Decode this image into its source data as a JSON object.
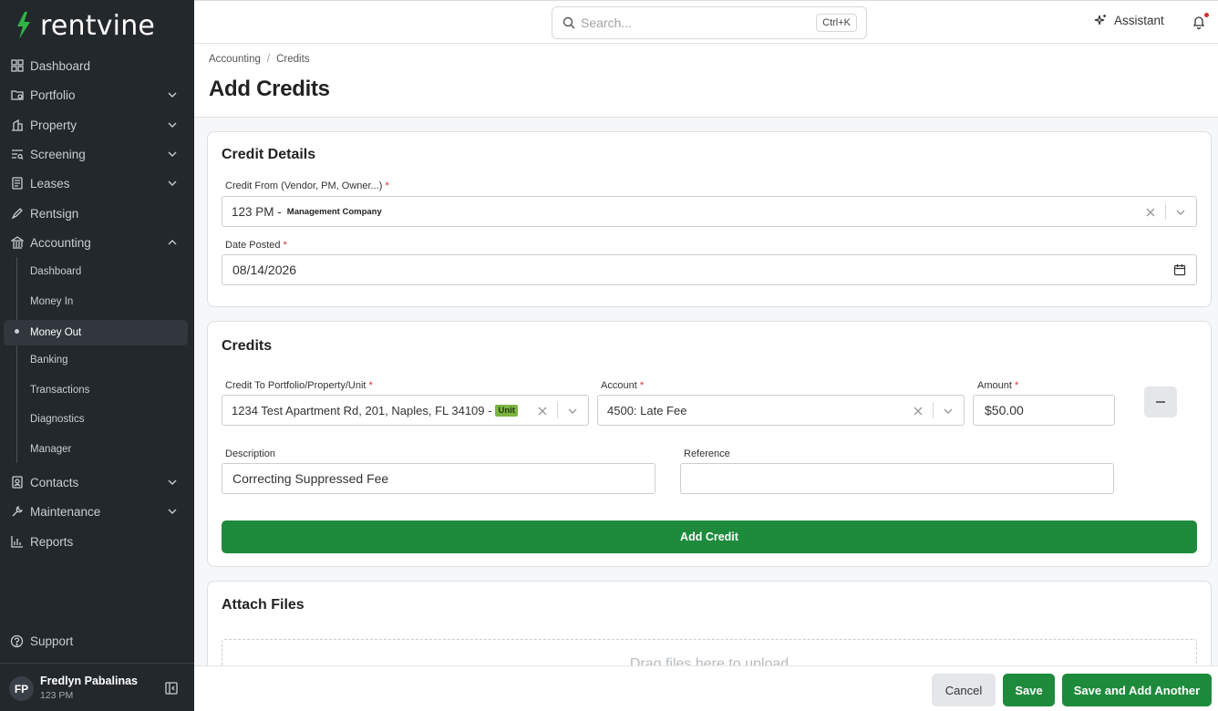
{
  "brand": {
    "name": "rentvine",
    "logo_color": "#2fb344"
  },
  "sidebar": {
    "items": [
      {
        "label": "Dashboard",
        "icon": "dashboard-icon",
        "has_chevron": false
      },
      {
        "label": "Portfolio",
        "icon": "portfolio-icon",
        "has_chevron": true
      },
      {
        "label": "Property",
        "icon": "property-icon",
        "has_chevron": true
      },
      {
        "label": "Screening",
        "icon": "screening-icon",
        "has_chevron": true
      },
      {
        "label": "Leases",
        "icon": "leases-icon",
        "has_chevron": true
      },
      {
        "label": "Rentsign",
        "icon": "rentsign-icon",
        "has_chevron": false
      },
      {
        "label": "Accounting",
        "icon": "accounting-icon",
        "has_chevron": true,
        "expanded": true
      },
      {
        "label": "Contacts",
        "icon": "contacts-icon",
        "has_chevron": true
      },
      {
        "label": "Maintenance",
        "icon": "maintenance-icon",
        "has_chevron": true
      },
      {
        "label": "Reports",
        "icon": "reports-icon",
        "has_chevron": false
      }
    ],
    "accounting_sub": [
      {
        "label": "Dashboard"
      },
      {
        "label": "Money In"
      },
      {
        "label": "Money Out",
        "active": true
      },
      {
        "label": "Banking"
      },
      {
        "label": "Transactions"
      },
      {
        "label": "Diagnostics"
      },
      {
        "label": "Manager"
      }
    ],
    "support_label": "Support",
    "user": {
      "initials": "FP",
      "name": "Fredlyn Pabalinas",
      "company": "123 PM"
    }
  },
  "topbar": {
    "search_placeholder": "Search...",
    "search_shortcut": "Ctrl+K",
    "assistant_label": "Assistant"
  },
  "breadcrumb": {
    "items": [
      "Accounting",
      "Credits"
    ],
    "separator": "/"
  },
  "page_title": "Add Credits",
  "credit_details": {
    "title": "Credit Details",
    "credit_from_label": "Credit From (Vendor, PM, Owner...)",
    "credit_from_value": "123 PM -",
    "credit_from_tag": "Management Company",
    "date_posted_label": "Date Posted",
    "date_posted_value": "08/14/2026"
  },
  "credits": {
    "title": "Credits",
    "credit_to_label": "Credit To Portfolio/Property/Unit",
    "credit_to_value": "1234 Test Apartment Rd, 201, Naples, FL 34109 -",
    "credit_to_badge": "Unit",
    "account_label": "Account",
    "account_value": "4500: Late Fee",
    "amount_label": "Amount",
    "amount_value": "$50.00",
    "description_label": "Description",
    "description_value": "Correcting Suppressed Fee",
    "reference_label": "Reference",
    "reference_value": "",
    "add_credit_label": "Add Credit"
  },
  "attach_files": {
    "title": "Attach Files",
    "dropzone_text": "Drag files here to upload"
  },
  "footer": {
    "cancel_label": "Cancel",
    "save_label": "Save",
    "save_another_label": "Save and Add Another"
  },
  "colors": {
    "primary_green": "#1e8a3c",
    "sidebar_bg": "#23282d",
    "required": "#d32f2f",
    "unit_badge": "#7cb342"
  }
}
